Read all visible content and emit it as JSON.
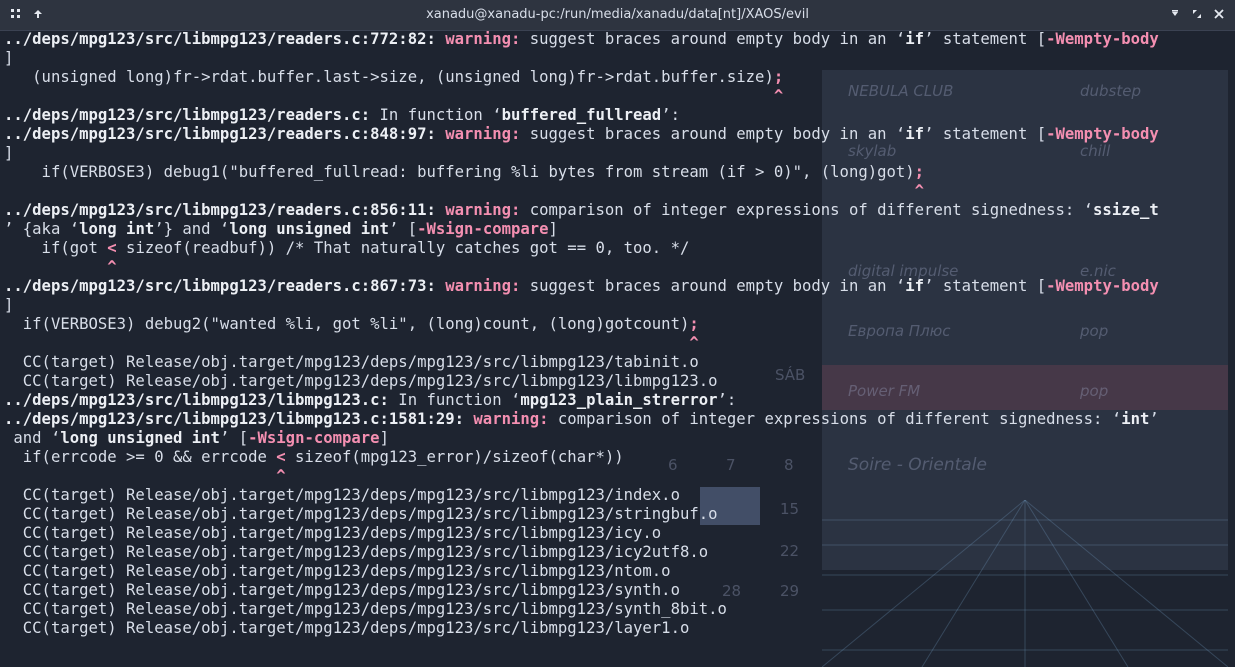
{
  "window": {
    "title": "xanadu@xanadu-pc:/run/media/xanadu/data[nt]/XAOS/evil",
    "icons": {
      "menu": "app-menu-icon",
      "pin": "pin-up-icon",
      "minimize": "minimize-icon",
      "maximize": "maximize-icon",
      "close": "close-icon"
    }
  },
  "wallpaper": {
    "stations": [
      {
        "name": "NEBULA CLUB",
        "genre": "dubstep"
      },
      {
        "name": "skylab",
        "genre": "chill"
      },
      {
        "name": "digital impulse",
        "genre": "e.nic"
      },
      {
        "name": "Европа Плюс",
        "genre": "pop"
      },
      {
        "name": "Power FM",
        "genre": "pop"
      },
      {
        "name": "Soire - Orientale",
        "genre": ""
      }
    ],
    "calendar_day": "SÁB",
    "calendar_nums": [
      "6",
      "7",
      "8",
      "15",
      "22",
      "28",
      "29"
    ]
  },
  "terminal": {
    "lines": [
      [
        {
          "t": "../deps/mpg123/src/libmpg123/readers.c:772:82: ",
          "c": "b"
        },
        {
          "t": "warning: ",
          "c": "warn"
        },
        {
          "t": "suggest braces around empty body in an ‘",
          "c": ""
        },
        {
          "t": "if",
          "c": "b"
        },
        {
          "t": "’ statement [",
          "c": ""
        },
        {
          "t": "-Wempty-body",
          "c": "flag"
        }
      ],
      [
        {
          "t": "]",
          "c": ""
        }
      ],
      [
        {
          "t": "   (unsigned long)fr->rdat.buffer.last->size, (unsigned long)fr->rdat.buffer.size)",
          "c": ""
        },
        {
          "t": ";",
          "c": "hl"
        }
      ],
      [
        {
          "t": "                                                                                  ^",
          "c": "caret"
        }
      ],
      [
        {
          "t": "../deps/mpg123/src/libmpg123/readers.c:",
          "c": "b"
        },
        {
          "t": " In function ‘",
          "c": ""
        },
        {
          "t": "buffered_fullread",
          "c": "b"
        },
        {
          "t": "’:",
          "c": ""
        }
      ],
      [
        {
          "t": "../deps/mpg123/src/libmpg123/readers.c:848:97: ",
          "c": "b"
        },
        {
          "t": "warning: ",
          "c": "warn"
        },
        {
          "t": "suggest braces around empty body in an ‘",
          "c": ""
        },
        {
          "t": "if",
          "c": "b"
        },
        {
          "t": "’ statement [",
          "c": ""
        },
        {
          "t": "-Wempty-body",
          "c": "flag"
        }
      ],
      [
        {
          "t": "]",
          "c": ""
        }
      ],
      [
        {
          "t": "    if(VERBOSE3) debug1(\"buffered_fullread: buffering %li bytes from stream (if > 0)\", (long)got)",
          "c": ""
        },
        {
          "t": ";",
          "c": "hl"
        }
      ],
      [
        {
          "t": "                                                                                                 ^",
          "c": "caret"
        }
      ],
      [
        {
          "t": "../deps/mpg123/src/libmpg123/readers.c:856:11: ",
          "c": "b"
        },
        {
          "t": "warning: ",
          "c": "warn"
        },
        {
          "t": "comparison of integer expressions of different signedness: ‘",
          "c": ""
        },
        {
          "t": "ssize_t",
          "c": "b"
        }
      ],
      [
        {
          "t": "’ {aka ‘",
          "c": ""
        },
        {
          "t": "long int",
          "c": "b"
        },
        {
          "t": "’} and ‘",
          "c": ""
        },
        {
          "t": "long unsigned int",
          "c": "b"
        },
        {
          "t": "’ [",
          "c": ""
        },
        {
          "t": "-Wsign-compare",
          "c": "flag"
        },
        {
          "t": "]",
          "c": ""
        }
      ],
      [
        {
          "t": "    if(got ",
          "c": ""
        },
        {
          "t": "<",
          "c": "hl"
        },
        {
          "t": " sizeof(readbuf)) /* That naturally catches got == 0, too. */",
          "c": ""
        }
      ],
      [
        {
          "t": "           ^",
          "c": "caret"
        }
      ],
      [
        {
          "t": "../deps/mpg123/src/libmpg123/readers.c:867:73: ",
          "c": "b"
        },
        {
          "t": "warning: ",
          "c": "warn"
        },
        {
          "t": "suggest braces around empty body in an ‘",
          "c": ""
        },
        {
          "t": "if",
          "c": "b"
        },
        {
          "t": "’ statement [",
          "c": ""
        },
        {
          "t": "-Wempty-body",
          "c": "flag"
        }
      ],
      [
        {
          "t": "]",
          "c": ""
        }
      ],
      [
        {
          "t": "  if(VERBOSE3) debug2(\"wanted %li, got %li\", (long)count, (long)gotcount)",
          "c": ""
        },
        {
          "t": ";",
          "c": "hl"
        }
      ],
      [
        {
          "t": "                                                                         ^",
          "c": "caret"
        }
      ],
      [
        {
          "t": "  CC(target) Release/obj.target/mpg123/deps/mpg123/src/libmpg123/tabinit.o",
          "c": ""
        }
      ],
      [
        {
          "t": "  CC(target) Release/obj.target/mpg123/deps/mpg123/src/libmpg123/libmpg123.o",
          "c": ""
        }
      ],
      [
        {
          "t": "../deps/mpg123/src/libmpg123/libmpg123.c:",
          "c": "b"
        },
        {
          "t": " In function ‘",
          "c": ""
        },
        {
          "t": "mpg123_plain_strerror",
          "c": "b"
        },
        {
          "t": "’:",
          "c": ""
        }
      ],
      [
        {
          "t": "../deps/mpg123/src/libmpg123/libmpg123.c:1581:29: ",
          "c": "b"
        },
        {
          "t": "warning: ",
          "c": "warn"
        },
        {
          "t": "comparison of integer expressions of different signedness: ‘",
          "c": ""
        },
        {
          "t": "int",
          "c": "b"
        },
        {
          "t": "’",
          "c": ""
        }
      ],
      [
        {
          "t": " and ‘",
          "c": ""
        },
        {
          "t": "long unsigned int",
          "c": "b"
        },
        {
          "t": "’ [",
          "c": ""
        },
        {
          "t": "-Wsign-compare",
          "c": "flag"
        },
        {
          "t": "]",
          "c": ""
        }
      ],
      [
        {
          "t": "  if(errcode >= 0 && errcode ",
          "c": ""
        },
        {
          "t": "<",
          "c": "hl"
        },
        {
          "t": " sizeof(mpg123_error)/sizeof(char*))",
          "c": ""
        }
      ],
      [
        {
          "t": "                             ^",
          "c": "caret"
        }
      ],
      [
        {
          "t": "  CC(target) Release/obj.target/mpg123/deps/mpg123/src/libmpg123/index.o",
          "c": ""
        }
      ],
      [
        {
          "t": "  CC(target) Release/obj.target/mpg123/deps/mpg123/src/libmpg123/stringbuf.o",
          "c": ""
        }
      ],
      [
        {
          "t": "  CC(target) Release/obj.target/mpg123/deps/mpg123/src/libmpg123/icy.o",
          "c": ""
        }
      ],
      [
        {
          "t": "  CC(target) Release/obj.target/mpg123/deps/mpg123/src/libmpg123/icy2utf8.o",
          "c": ""
        }
      ],
      [
        {
          "t": "  CC(target) Release/obj.target/mpg123/deps/mpg123/src/libmpg123/ntom.o",
          "c": ""
        }
      ],
      [
        {
          "t": "  CC(target) Release/obj.target/mpg123/deps/mpg123/src/libmpg123/synth.o",
          "c": ""
        }
      ],
      [
        {
          "t": "  CC(target) Release/obj.target/mpg123/deps/mpg123/src/libmpg123/synth_8bit.o",
          "c": ""
        }
      ],
      [
        {
          "t": "  CC(target) Release/obj.target/mpg123/deps/mpg123/src/libmpg123/layer1.o",
          "c": ""
        }
      ]
    ]
  }
}
